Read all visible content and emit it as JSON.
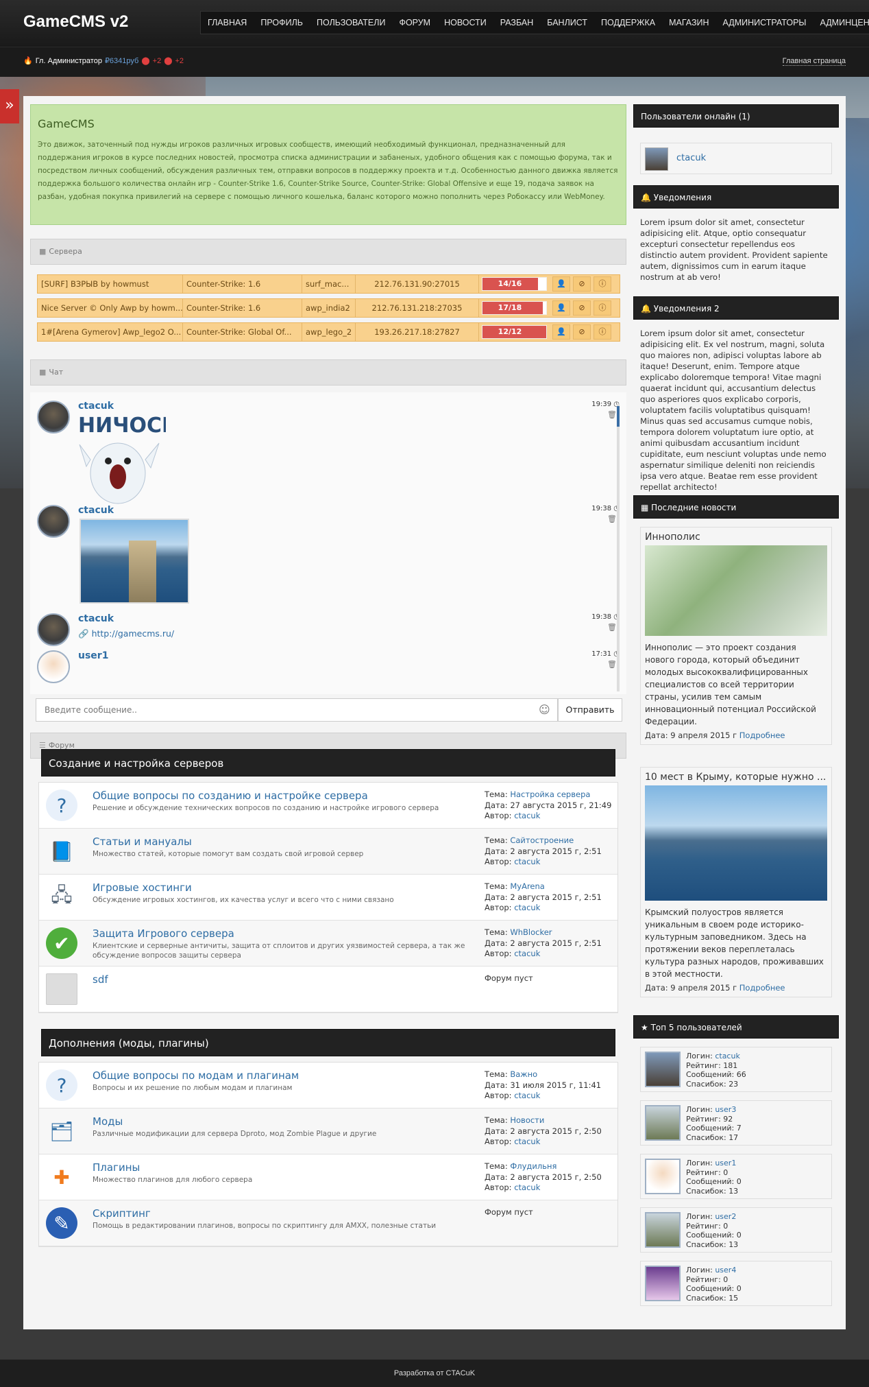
{
  "header": {
    "logo": "GameCMS v2",
    "nav": [
      "Главная",
      "Профиль",
      "Пользователи",
      "Форум",
      "Новости",
      "Разбан",
      "Банлист",
      "Поддержка",
      "Магазин",
      "Администраторы",
      "Админцентр"
    ]
  },
  "userbar": {
    "user": "Гл. Администратор",
    "money": "₽6341руб",
    "badge1": "+2",
    "badge2": "+2",
    "crumb": "Главная страница"
  },
  "welcome": {
    "title": "GameCMS",
    "text": "Это движок, заточенный под нужды игроков различных игровых сообществ, имеющий необходимый функционал, предназначенный для поддержания игроков в курсе последних новостей, просмотра списка администрации и забаненых, удобного общения как с помощью форума, так и посредством личных сообщений, обсуждения различных тем, отправки вопросов в поддержку проекта и т.д. Особенностью данного движка является поддержка большого количества онлайн игр - Counter-Strike 1.6, Counter-Strike Source, Counter-Strike: Global Offensive и еще 19, подача заявок на разбан, удобная покупка привилегий на сервере с помощью личного кошелька, баланс которого можно пополнить через Робокассу или WebMoney."
  },
  "sections": {
    "servers": "Сервера",
    "chat": "Чат",
    "forum": "Форум"
  },
  "servers": [
    {
      "name": "[SURF] ВЗРЫВ by howmust",
      "game": "Counter-Strike: 1.6",
      "map": "surf_mac...",
      "ip": "212.76.131.90:27015",
      "players": "14/16",
      "fill": 0.875
    },
    {
      "name": "Nice Server © Only Awp by howm...",
      "game": "Counter-Strike: 1.6",
      "map": "awp_india2",
      "ip": "212.76.131.218:27035",
      "players": "17/18",
      "fill": 0.944
    },
    {
      "name": "1#[Arena Gymerov] Awp_lego2 O...",
      "game": "Counter-Strike: Global Of...",
      "map": "awp_lego_2",
      "ip": "193.26.217.18:27827",
      "players": "12/12",
      "fill": 1.0
    }
  ],
  "chat": {
    "messages": [
      {
        "user": "ctacuk",
        "time": "19:39",
        "sticker": "НИЧОСИ"
      },
      {
        "user": "ctacuk",
        "time": "19:38"
      },
      {
        "user": "ctacuk",
        "time": "19:38",
        "link": "http://gamecms.ru/"
      },
      {
        "user": "user1",
        "time": "17:31"
      }
    ],
    "placeholder": "Введите сообщение..",
    "send": "Отправить"
  },
  "forum": {
    "categories": [
      {
        "title": "Создание и настройка серверов",
        "rows": [
          {
            "icon": "question-icon",
            "title": "Общие вопросы по созданию и настройке сервера",
            "desc": "Решение и обсуждение технических вопросов по созданию и настройке игрового сервера",
            "theme": "Настройка сервера",
            "date": "27 августа 2015 г, 21:49",
            "author": "ctacuk"
          },
          {
            "icon": "book-icon",
            "title": "Статьи и мануалы",
            "desc": "Множество статей, которые помогут вам создать свой игровой сервер",
            "theme": "Сайтостроение",
            "date": "2 августа 2015 г, 2:51",
            "author": "ctacuk"
          },
          {
            "icon": "hosting-icon",
            "title": "Игровые хостинги",
            "desc": "Обсуждение игровых хостингов, их качества услуг и всего что с ними связано",
            "theme": "MyArena",
            "date": "2 августа 2015 г, 2:51",
            "author": "ctacuk"
          },
          {
            "icon": "shield-icon",
            "title": "Защита Игрового сервера",
            "desc": "Клиентские и серверные античиты, защита от сплоитов и других уязвимостей сервера, а так же обсуждение вопросов защиты сервера",
            "theme": "WhBlocker",
            "date": "2 августа 2015 г, 2:51",
            "author": "ctacuk"
          },
          {
            "icon": "image-icon",
            "title": "sdf",
            "desc": "",
            "empty": "Форум пуст"
          }
        ]
      },
      {
        "title": "Дополнения (моды, плагины)",
        "rows": [
          {
            "icon": "question-icon",
            "title": "Общие вопросы по модам и плагинам",
            "desc": "Вопросы и их решение по любым модам и плагинам",
            "theme": "Важно",
            "date": "31 июля 2015 г, 11:41",
            "author": "ctacuk"
          },
          {
            "icon": "mods-icon",
            "title": "Моды",
            "desc": "Различные модификации для сервера Dproto, мод Zombie Plague и другие",
            "theme": "Новости",
            "date": "2 августа 2015 г, 2:50",
            "author": "ctacuk"
          },
          {
            "icon": "puzzle-icon",
            "title": "Плагины",
            "desc": "Множество плагинов для любого сервера",
            "theme": "Флудильня",
            "date": "2 августа 2015 г, 2:50",
            "author": "ctacuk"
          },
          {
            "icon": "script-icon",
            "title": "Скриптинг",
            "desc": "Помощь в редактировании плагинов, вопросы по скриптингу для AMXX, полезные статьи",
            "empty": "Форум пуст"
          }
        ]
      }
    ],
    "labels": {
      "theme": "Тема:",
      "date": "Дата:",
      "author": "Автор:"
    }
  },
  "sidebar": {
    "online": {
      "title": "Пользователи онлайн (1)",
      "user": "ctacuk"
    },
    "notice1": {
      "title": "Уведомления",
      "text": "Lorem ipsum dolor sit amet, consectetur adipisicing elit. Atque, optio consequatur excepturi consectetur repellendus eos distinctio autem provident. Provident sapiente autem, dignissimos cum in earum itaque nostrum at ab vero!"
    },
    "notice2": {
      "title": "Уведомления 2",
      "text": "Lorem ipsum dolor sit amet, consectetur adipisicing elit. Ex vel nostrum, magni, soluta quo maiores non, adipisci voluptas labore ab itaque! Deserunt, enim. Tempore atque explicabo doloremque tempora! Vitae magni quaerat incidunt qui, accusantium delectus quo asperiores quos explicabo corporis, voluptatem facilis voluptatibus quisquam! Minus quas sed accusamus cumque nobis, tempora dolorem voluptatum iure optio, at animi quibusdam accusantium incidunt cupiditate, eum nesciunt voluptas unde nemo aspernatur similique deleniti non reiciendis ipsa vero atque. Beatae rem esse provident repellat architecto!"
    },
    "news": {
      "title": "Последние новости",
      "items": [
        {
          "title": "Иннополис",
          "text": "Иннополис — это проект создания нового города, который объединит молодых высококвалифицированных специалистов со всей территории страны, усилив тем самым инновационный потенциал Российской Федерации.",
          "date": "Дата: 9 апреля 2015 г",
          "more": "Подробнее"
        },
        {
          "title": "10 мест в Крыму, которые нужно ...",
          "text": "Крымский полуостров является уникальным в своем роде историко-культурным заповедником. Здесь на протяжении веков переплеталась культура разных народов, проживавших в этой местности.",
          "date": "Дата: 9 апреля 2015 г",
          "more": "Подробнее"
        }
      ]
    },
    "top": {
      "title": "Топ 5 пользователей",
      "labels": {
        "login": "Логин:",
        "rating": "Рейтинг:",
        "msgs": "Сообщений:",
        "thanks": "Спасибок:"
      },
      "users": [
        {
          "login": "ctacuk",
          "rating": "181",
          "msgs": "66",
          "thanks": "23"
        },
        {
          "login": "user3",
          "rating": "92",
          "msgs": "7",
          "thanks": "17"
        },
        {
          "login": "user1",
          "rating": "0",
          "msgs": "0",
          "thanks": "13"
        },
        {
          "login": "user2",
          "rating": "0",
          "msgs": "0",
          "thanks": "13"
        },
        {
          "login": "user4",
          "rating": "0",
          "msgs": "0",
          "thanks": "15"
        }
      ]
    }
  },
  "footer": "Разработка от CTACuK"
}
